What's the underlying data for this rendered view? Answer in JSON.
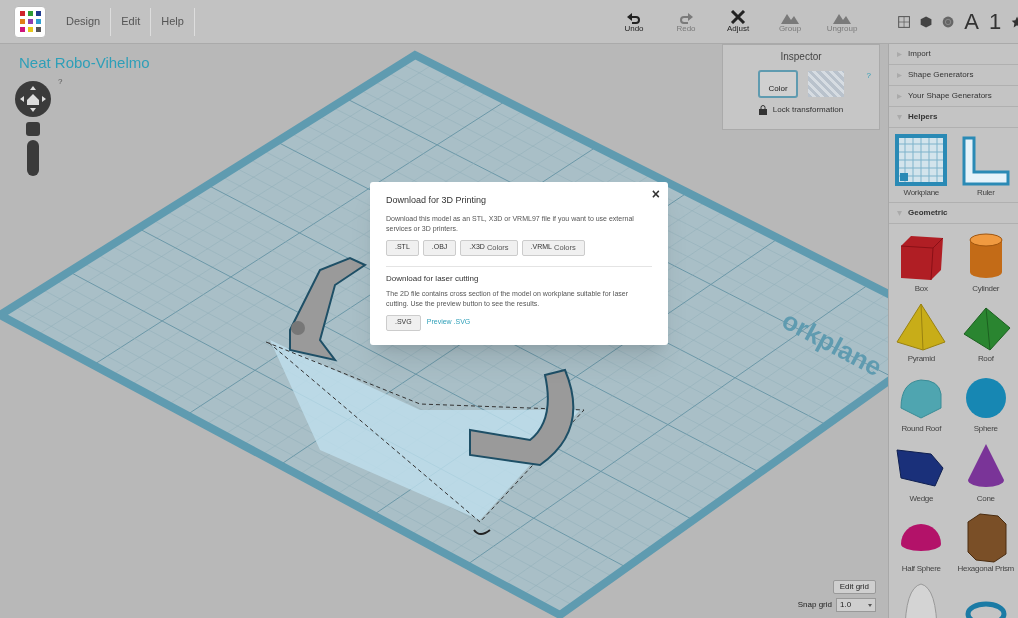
{
  "app": {
    "menu": [
      {
        "label": "Design"
      },
      {
        "label": "Edit"
      },
      {
        "label": "Help"
      }
    ],
    "design_title": "Neat Robo-Vihelmo",
    "help_mark": "?"
  },
  "toolbar": [
    {
      "label": "Undo",
      "kind": "undo",
      "disabled": false
    },
    {
      "label": "Redo",
      "kind": "redo",
      "disabled": true
    },
    {
      "label": "Adjust",
      "kind": "adjust",
      "disabled": false
    },
    {
      "label": "Group",
      "kind": "group",
      "disabled": true
    },
    {
      "label": "Ungroup",
      "kind": "ungroup",
      "disabled": true
    }
  ],
  "view_buttons": [
    {
      "kind": "grid"
    },
    {
      "kind": "cube"
    },
    {
      "kind": "ball"
    },
    {
      "kind": "text",
      "label": "A"
    },
    {
      "kind": "text",
      "label": "1"
    },
    {
      "kind": "star"
    }
  ],
  "inspector": {
    "title": "Inspector",
    "color_label": "Color",
    "help": "?",
    "lock_label": "Lock transformation"
  },
  "workplane_label": "orkplane",
  "sidebar": {
    "sections": [
      {
        "label": "Import",
        "expanded": false
      },
      {
        "label": "Shape Generators",
        "expanded": false
      },
      {
        "label": "Your Shape Generators",
        "expanded": false
      },
      {
        "label": "Helpers",
        "expanded": true,
        "items": [
          {
            "label": "Workplane",
            "kind": "workplane",
            "color": "#2a8ab5"
          },
          {
            "label": "Ruler",
            "kind": "ruler",
            "color": "#2a8ab5"
          }
        ]
      },
      {
        "label": "Geometric",
        "expanded": true,
        "items": [
          {
            "label": "Box",
            "kind": "box",
            "color": "#b01e24"
          },
          {
            "label": "Cylinder",
            "kind": "cylinder",
            "color": "#c36b17"
          },
          {
            "label": "Pyramid",
            "kind": "pyramid",
            "color": "#c8ad18"
          },
          {
            "label": "Roof",
            "kind": "roof",
            "color": "#2a8530"
          },
          {
            "label": "Round Roof",
            "kind": "roundroof",
            "color": "#4fa5b0"
          },
          {
            "label": "Sphere",
            "kind": "sphere",
            "color": "#1787b3"
          },
          {
            "label": "Wedge",
            "kind": "wedge",
            "color": "#1a307a"
          },
          {
            "label": "Cone",
            "kind": "cone",
            "color": "#7a3498"
          },
          {
            "label": "Half Sphere",
            "kind": "halfsphere",
            "color": "#b31269"
          },
          {
            "label": "Hexagonal Prism",
            "kind": "hexprism",
            "color": "#7a4f27"
          },
          {
            "kind": "paraboloid",
            "color": "#d4d4d4"
          },
          {
            "kind": "torus",
            "color": "#1b7ba5"
          }
        ]
      }
    ]
  },
  "grid": {
    "edit_label": "Edit grid",
    "snap_label": "Snap grid",
    "snap_value": "1.0"
  },
  "dialog": {
    "title": "Download for 3D Printing",
    "text": "Download this model as an STL, X3D or VRML97 file if you want to use external services or 3D printers.",
    "buttons": [
      {
        "label": ".STL"
      },
      {
        "label": ".OBJ"
      },
      {
        "label": ".X3D",
        "note": "Colors"
      },
      {
        "label": ".VRML",
        "note": "Colors"
      }
    ],
    "laser_title": "Download for laser cutting",
    "laser_text": "The 2D file contains cross section of the model on workplane suitable for laser cutting. Use the preview button to see the results.",
    "svg_button": ".SVG",
    "preview_link": "Preview .SVG",
    "close": "×"
  }
}
